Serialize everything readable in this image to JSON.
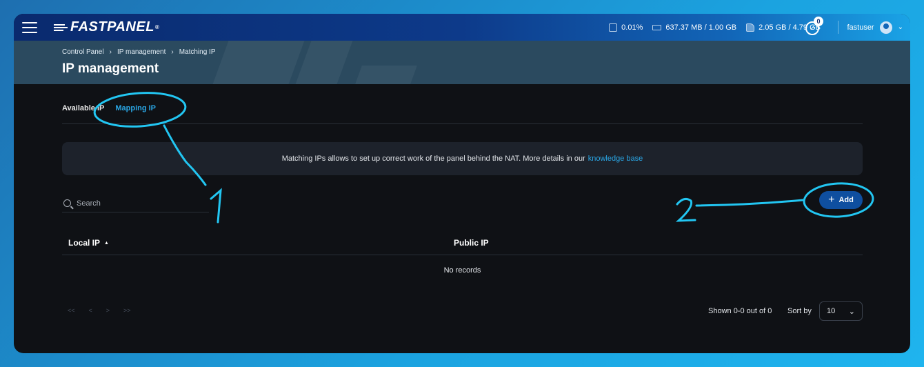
{
  "topbar": {
    "brand": "FASTPANEL",
    "brand_mark": "®",
    "cpu": "0.01%",
    "ram": "637.37 MB / 1.00 GB",
    "disk": "2.05 GB / 4.79 GB",
    "notifications": "0",
    "username": "fastuser"
  },
  "breadcrumb": [
    "Control Panel",
    "IP management",
    "Matching IP"
  ],
  "breadcrumb_sep": "›",
  "page_title": "IP management",
  "tabs": [
    {
      "label": "Available IP",
      "active": false
    },
    {
      "label": "Mapping IP",
      "active": true
    }
  ],
  "info": {
    "text": "Matching IPs allows to set up correct work of the panel behind the NAT. More details in our",
    "link": "knowledge base"
  },
  "search": {
    "placeholder": "Search"
  },
  "add_button": {
    "label": "Add"
  },
  "table": {
    "columns": [
      "Local IP",
      "Public IP"
    ],
    "empty": "No records"
  },
  "pagination": {
    "first": "<<",
    "prev": "<",
    "next": ">",
    "last": ">>",
    "shown": "Shown 0-0 out of 0",
    "sort_label": "Sort by",
    "page_size": "10"
  },
  "annotations": {
    "one": "1",
    "two": "2"
  },
  "colors": {
    "accent": "#2aa7e6",
    "annotation": "#22c6f2",
    "button": "#0f4fa0"
  }
}
